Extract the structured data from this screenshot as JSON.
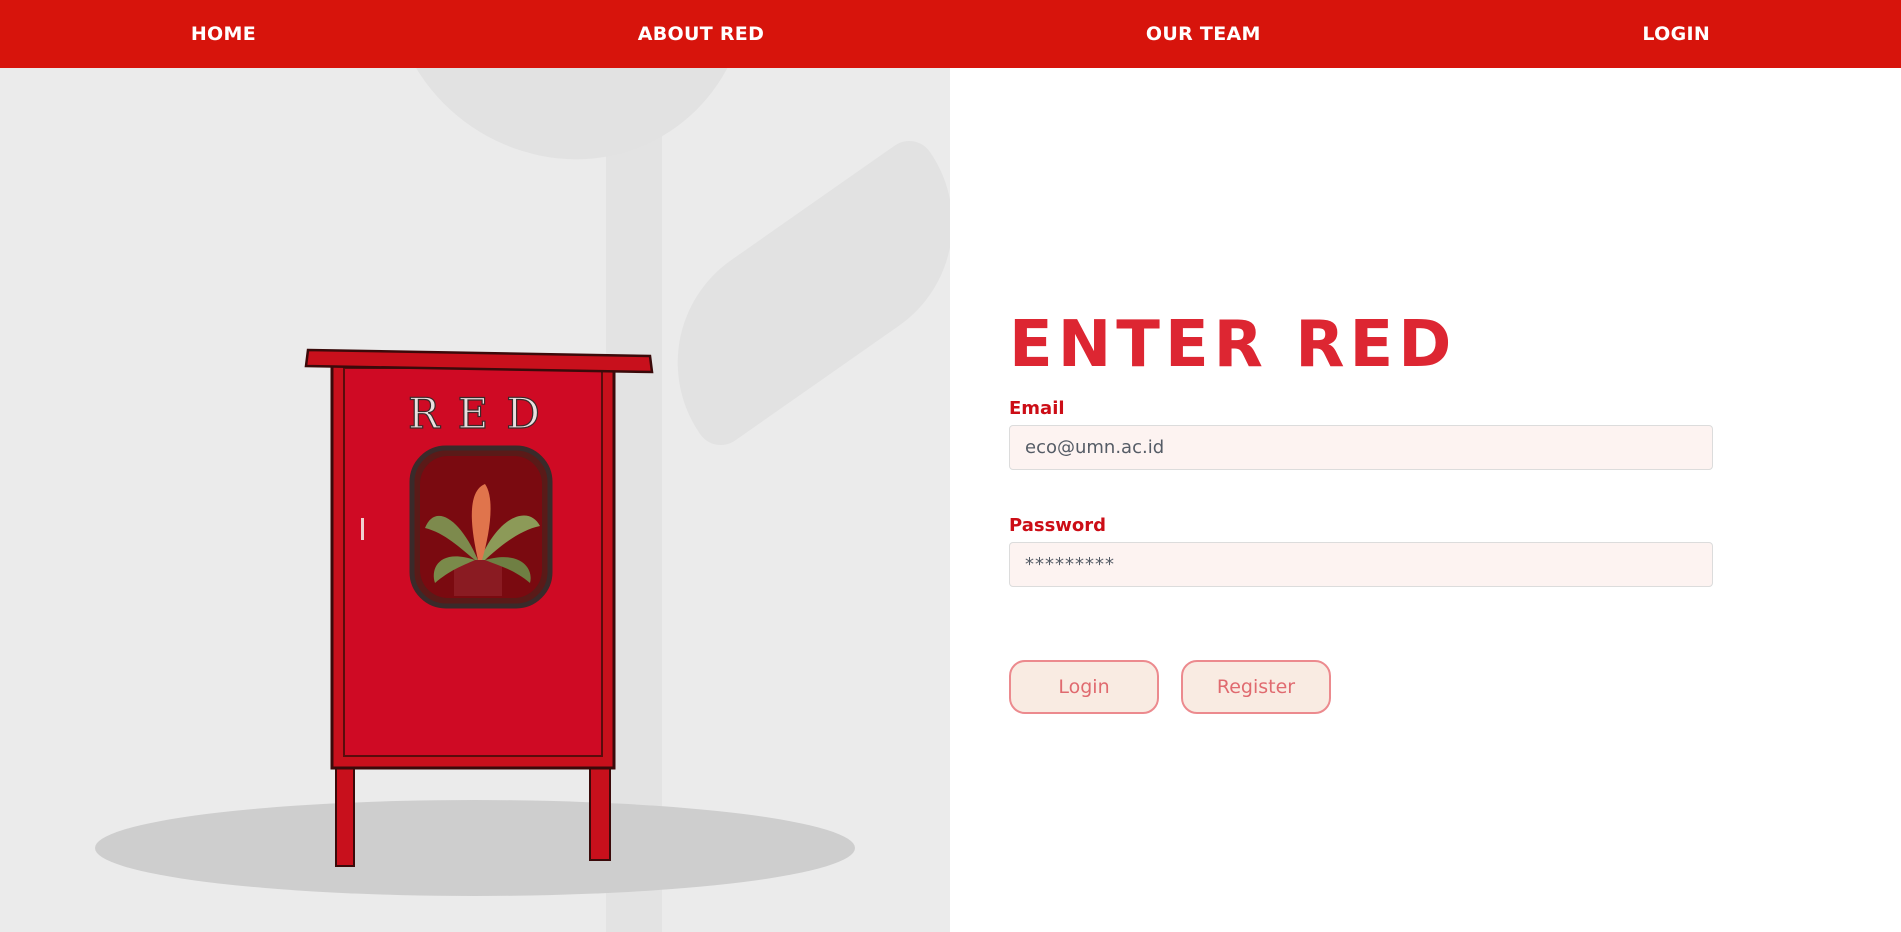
{
  "nav": {
    "home": "HOME",
    "about": "ABOUT RED",
    "team": "OUR TEAM",
    "login": "LOGIN"
  },
  "illustration": {
    "cabinet_sign": "RED"
  },
  "form": {
    "title": "ENTER RED",
    "email_label": "Email",
    "email_value": "eco@umn.ac.id",
    "password_label": "Password",
    "password_value": "*********",
    "login_button": "Login",
    "register_button": "Register"
  },
  "colors": {
    "nav_red": "#d7140c",
    "title_red": "#dd2632",
    "label_red": "#cc0d16",
    "button_border": "#ec8a8e",
    "button_fill": "#f9ebe2"
  }
}
